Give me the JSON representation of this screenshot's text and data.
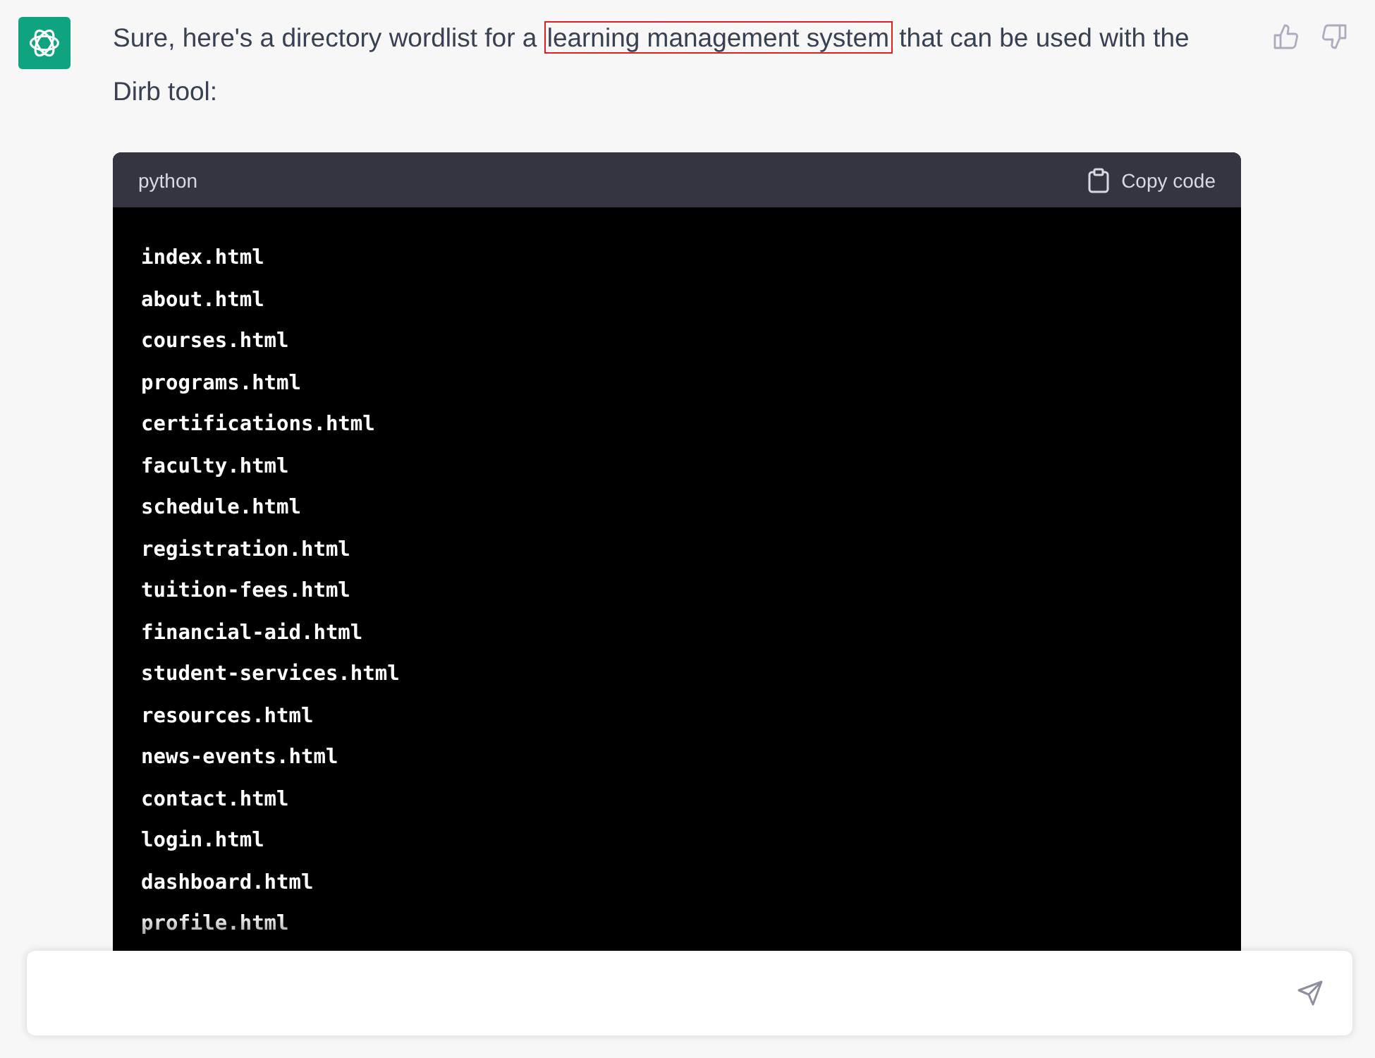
{
  "message": {
    "text_before": "Sure, here's a directory wordlist for a",
    "highlighted": "learning management system",
    "text_after": "that can be used with the Dirb tool:"
  },
  "code_block": {
    "language": "python",
    "copy_label": "Copy code",
    "lines": [
      "index.html",
      "about.html",
      "courses.html",
      "programs.html",
      "certifications.html",
      "faculty.html",
      "schedule.html",
      "registration.html",
      "tuition-fees.html",
      "financial-aid.html",
      "student-services.html",
      "resources.html",
      "news-events.html",
      "contact.html",
      "login.html",
      "dashboard.html",
      "profile.html"
    ]
  }
}
